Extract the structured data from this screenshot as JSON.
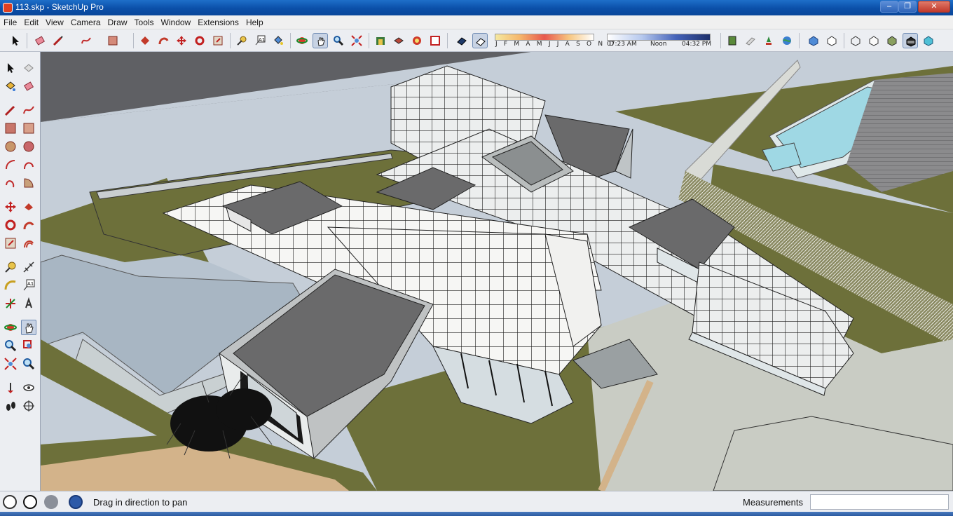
{
  "window": {
    "title": "113.skp - SketchUp Pro",
    "minimize_label": "–",
    "maximize_label": "❐",
    "close_label": "✕"
  },
  "menu": {
    "items": [
      "File",
      "Edit",
      "View",
      "Camera",
      "Draw",
      "Tools",
      "Window",
      "Extensions",
      "Help"
    ]
  },
  "shadows": {
    "months": "J F M A M J J A S O N D",
    "time_start": "07:23 AM",
    "time_noon": "Noon",
    "time_end": "04:32 PM"
  },
  "status": {
    "hint": "Drag in direction to pan",
    "measurements_label": "Measurements",
    "measurements_value": ""
  },
  "colors": {
    "title_bar": "#0b4fa8",
    "grass": "#6e703a",
    "water": "#9fd8e4",
    "building_white": "#f4f5f2",
    "roof_dark": "#6a6a6b"
  },
  "icons": {
    "toolbar": [
      "select-arrow-icon",
      "eraser-icon",
      "pencil-line-icon",
      "freehand-icon",
      "rectangle-icon",
      "push-pull-icon",
      "follow-me-icon",
      "move-icon",
      "rotate-icon",
      "scale-icon",
      "tape-measure-icon",
      "text-label-icon",
      "paint-bucket-icon",
      "orbit-icon",
      "pan-hand-icon",
      "zoom-icon",
      "zoom-extents-icon",
      "warehouse-icon",
      "components-icon",
      "extension-icon",
      "send-to-layout-icon",
      "xray-icon",
      "back-edges-icon",
      "section-icon",
      "section-fill-icon",
      "location-pin-icon",
      "globe-icon",
      "wireframe-icon",
      "hidden-line-icon",
      "shaded-icon",
      "shaded-texture-icon",
      "monochrome-icon",
      "iso-view-icon",
      "top-view-icon"
    ]
  }
}
